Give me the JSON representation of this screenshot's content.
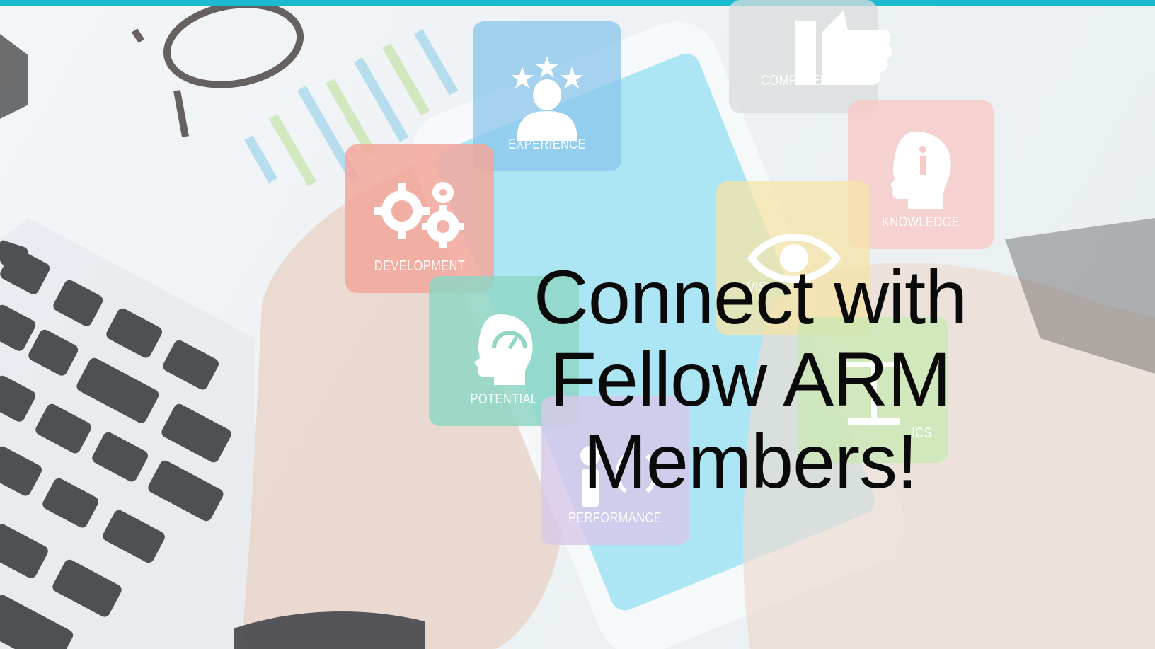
{
  "top_bar": {
    "color": "#1bbad0"
  },
  "tiles": {
    "experience": {
      "label": "EXPERIENCE",
      "color": "#8ec8ec",
      "icon": "person-with-stars-icon"
    },
    "competence": {
      "label": "COMPETENCE",
      "color": "#d9dcde",
      "icon": "thumbs-up-icon"
    },
    "development": {
      "label": "DEVELOPMENT",
      "color": "#f2a79b",
      "icon": "gears-icon"
    },
    "knowledge": {
      "label": "KNOWLEDGE",
      "color": "#f8c9c6",
      "icon": "head-info-icon"
    },
    "vision": {
      "label": "VISI",
      "color": "#f5e3a6",
      "icon": "eye-icon"
    },
    "potential": {
      "label": "POTENTIAL",
      "color": "#8fd6c5",
      "icon": "head-gauge-icon"
    },
    "ethics": {
      "label": "ICS",
      "color": "#c8e8b2",
      "icon": "scales-icon"
    },
    "performance": {
      "label": "PERFORMANCE",
      "color": "#d8c7ea",
      "icon": "person-performance-icon"
    }
  },
  "headline": {
    "line1": "Connect with",
    "line2": "Fellow ARM",
    "line3": "Members!"
  }
}
